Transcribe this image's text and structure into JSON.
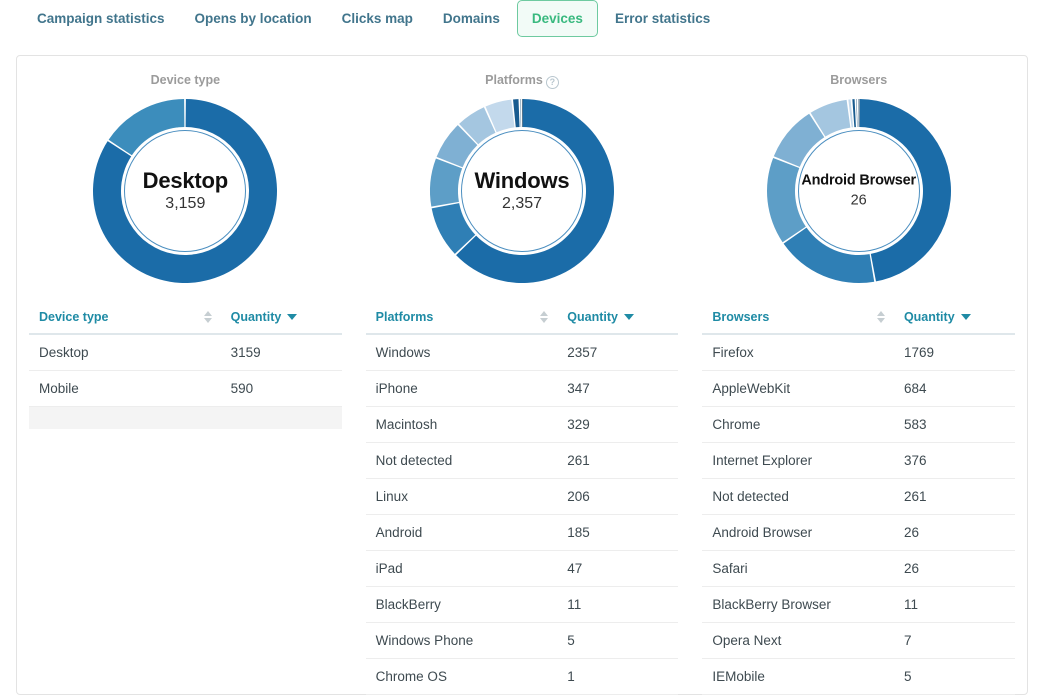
{
  "tabs": [
    {
      "label": "Campaign statistics",
      "active": false
    },
    {
      "label": "Opens by location",
      "active": false
    },
    {
      "label": "Clicks map",
      "active": false
    },
    {
      "label": "Domains",
      "active": false
    },
    {
      "label": "Devices",
      "active": true
    },
    {
      "label": "Error statistics",
      "active": false
    }
  ],
  "colors": {
    "tab_text": "#41758c",
    "tab_active_text": "#39b97f",
    "tab_active_bg": "#f2fbf7",
    "tab_active_border": "#6ecaa0",
    "table_header_text": "#1f8ba5",
    "chart_title": "#9b9b9b",
    "donut_palette": [
      "#1b6ca8",
      "#2f7fb5",
      "#3c8dbc",
      "#5d9ec7",
      "#7fb0d3",
      "#a4c6e0",
      "#c3d9ec",
      "#185b8f",
      "#0f4c7a",
      "#123f63",
      "#0b3350",
      "#07263c"
    ]
  },
  "panels": [
    {
      "id": "device-type",
      "chart_title": "Device type",
      "has_help_icon": false,
      "center_label": "Desktop",
      "center_value": "3,159",
      "center_small": false,
      "columns": [
        "Device type",
        "Quantity"
      ],
      "sort": {
        "column": "Quantity",
        "direction": "desc"
      },
      "rows": [
        {
          "name": "Desktop",
          "quantity": "3159"
        },
        {
          "name": "Mobile",
          "quantity": "590"
        }
      ],
      "footer_row": true
    },
    {
      "id": "platforms",
      "chart_title": "Platforms",
      "has_help_icon": true,
      "center_label": "Windows",
      "center_value": "2,357",
      "center_small": false,
      "columns": [
        "Platforms",
        "Quantity"
      ],
      "sort": {
        "column": "Quantity",
        "direction": "desc"
      },
      "rows": [
        {
          "name": "Windows",
          "quantity": "2357"
        },
        {
          "name": "iPhone",
          "quantity": "347"
        },
        {
          "name": "Macintosh",
          "quantity": "329"
        },
        {
          "name": "Not detected",
          "quantity": "261"
        },
        {
          "name": "Linux",
          "quantity": "206"
        },
        {
          "name": "Android",
          "quantity": "185"
        },
        {
          "name": "iPad",
          "quantity": "47"
        },
        {
          "name": "BlackBerry",
          "quantity": "11"
        },
        {
          "name": "Windows Phone",
          "quantity": "5"
        },
        {
          "name": "Chrome OS",
          "quantity": "1"
        }
      ],
      "footer_row": false
    },
    {
      "id": "browsers",
      "chart_title": "Browsers",
      "has_help_icon": false,
      "center_label": "Android Browser",
      "center_value": "26",
      "center_small": true,
      "columns": [
        "Browsers",
        "Quantity"
      ],
      "sort": {
        "column": "Quantity",
        "direction": "desc"
      },
      "rows": [
        {
          "name": "Firefox",
          "quantity": "1769"
        },
        {
          "name": "AppleWebKit",
          "quantity": "684"
        },
        {
          "name": "Chrome",
          "quantity": "583"
        },
        {
          "name": "Internet Explorer",
          "quantity": "376"
        },
        {
          "name": "Not detected",
          "quantity": "261"
        },
        {
          "name": "Android Browser",
          "quantity": "26"
        },
        {
          "name": "Safari",
          "quantity": "26"
        },
        {
          "name": "BlackBerry Browser",
          "quantity": "11"
        },
        {
          "name": "Opera Next",
          "quantity": "7"
        },
        {
          "name": "IEMobile",
          "quantity": "5"
        }
      ],
      "footer_row": false
    }
  ],
  "chart_data": [
    {
      "type": "pie",
      "title": "Device type",
      "donut": true,
      "categories": [
        "Desktop",
        "Mobile"
      ],
      "values": [
        3159,
        590
      ],
      "total": 3749,
      "center_label": "Desktop",
      "center_value": "3,159",
      "colors": [
        "#1b6ca8",
        "#3c8dbc"
      ],
      "legend": "none"
    },
    {
      "type": "pie",
      "title": "Platforms",
      "donut": true,
      "categories": [
        "Windows",
        "iPhone",
        "Macintosh",
        "Not detected",
        "Linux",
        "Android",
        "iPad",
        "BlackBerry",
        "Windows Phone",
        "Chrome OS"
      ],
      "values": [
        2357,
        347,
        329,
        261,
        206,
        185,
        47,
        11,
        5,
        1
      ],
      "total": 3749,
      "center_label": "Windows",
      "center_value": "2,357",
      "colors": [
        "#1b6ca8",
        "#2f7fb5",
        "#5d9ec7",
        "#7fb0d3",
        "#a4c6e0",
        "#c3d9ec",
        "#185b8f",
        "#0f4c7a",
        "#123f63",
        "#0b3350"
      ],
      "legend": "none"
    },
    {
      "type": "pie",
      "title": "Browsers",
      "donut": true,
      "categories": [
        "Firefox",
        "AppleWebKit",
        "Chrome",
        "Internet Explorer",
        "Not detected",
        "Android Browser",
        "Safari",
        "BlackBerry Browser",
        "Opera Next",
        "IEMobile"
      ],
      "values": [
        1769,
        684,
        583,
        376,
        261,
        26,
        26,
        11,
        7,
        5
      ],
      "total": 3748,
      "center_label": "Android Browser",
      "center_value": "26",
      "colors": [
        "#1b6ca8",
        "#2f7fb5",
        "#5d9ec7",
        "#7fb0d3",
        "#a4c6e0",
        "#c3d9ec",
        "#185b8f",
        "#0f4c7a",
        "#123f63",
        "#0b3350"
      ],
      "legend": "none"
    }
  ]
}
